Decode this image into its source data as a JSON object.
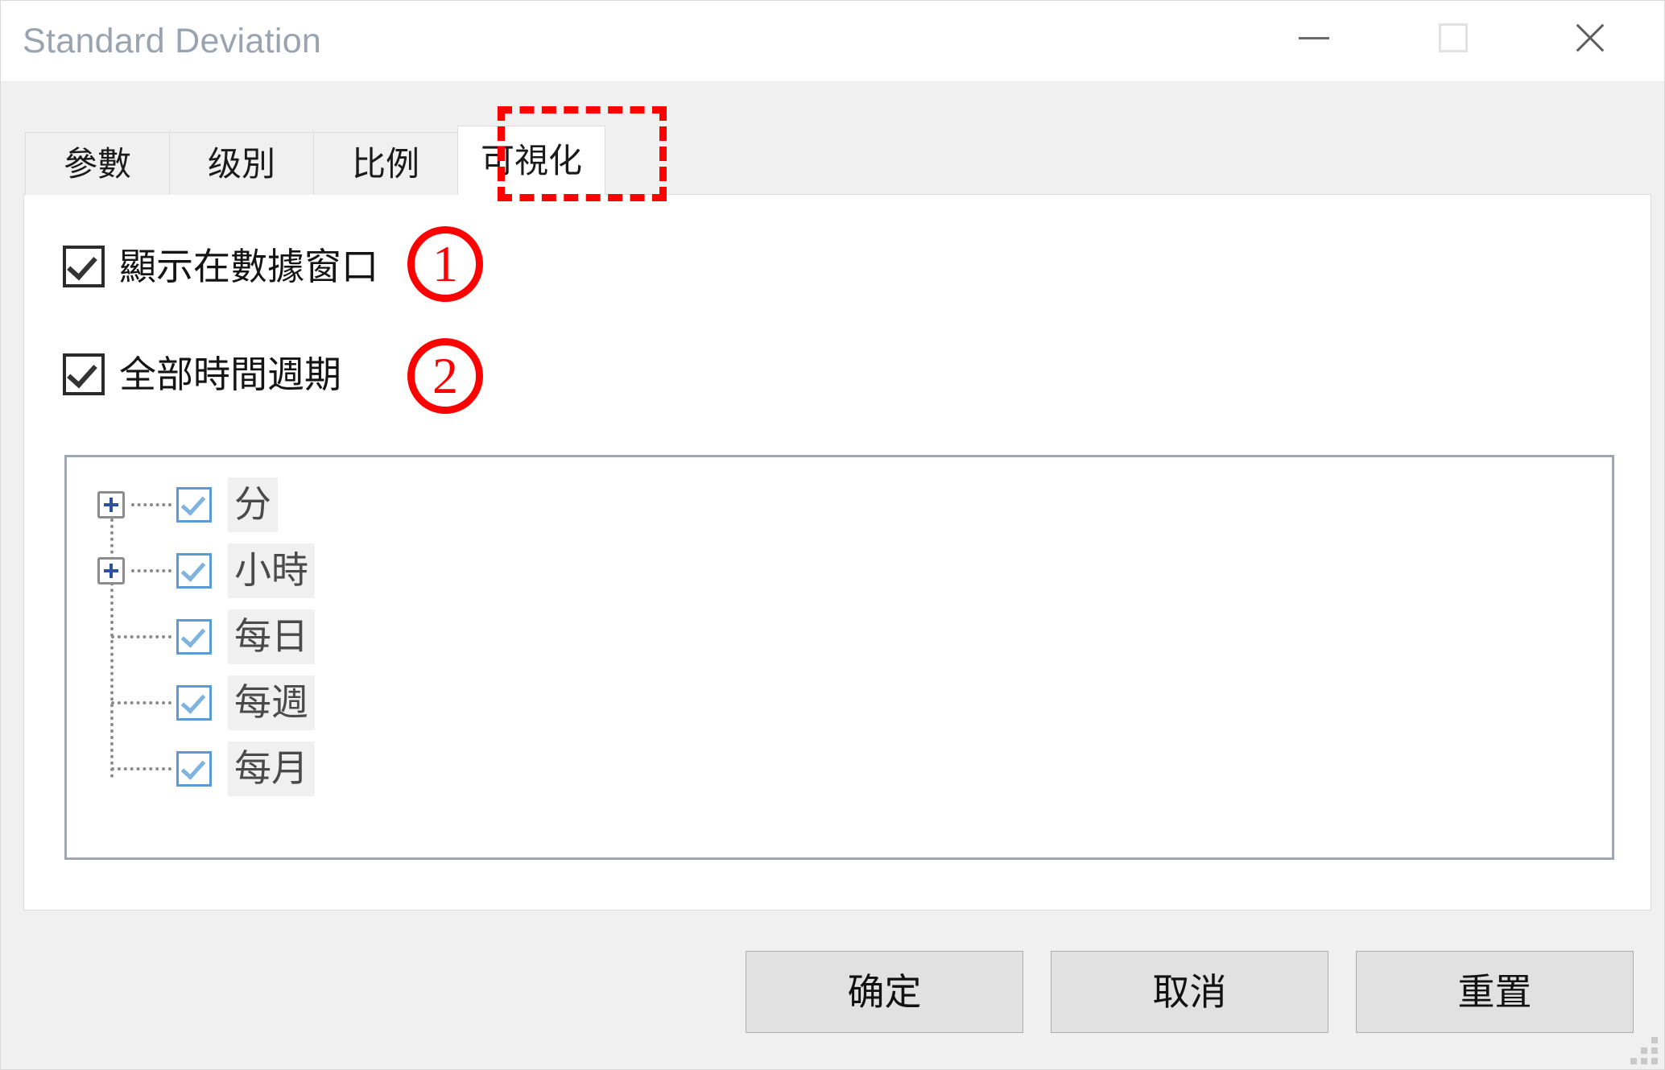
{
  "window": {
    "title": "Standard Deviation",
    "controls": [
      {
        "name": "minimize",
        "glyph": "minimize-icon"
      },
      {
        "name": "maximize",
        "glyph": "maximize-icon"
      },
      {
        "name": "close",
        "glyph": "close-icon"
      }
    ]
  },
  "tabs": [
    {
      "label": "參數",
      "selected": false
    },
    {
      "label": "级別",
      "selected": false
    },
    {
      "label": "比例",
      "selected": false
    },
    {
      "label": "可視化",
      "selected": true
    }
  ],
  "options": [
    {
      "label": "顯示在數據窗口",
      "checked": true,
      "annotation": "1"
    },
    {
      "label": "全部時間週期",
      "checked": true,
      "annotation": "2"
    }
  ],
  "timeframe_tree": {
    "items": [
      {
        "label": "分",
        "checked": true,
        "expandable": true,
        "expander": "plus-icon"
      },
      {
        "label": "小時",
        "checked": true,
        "expandable": true,
        "expander": "plus-icon"
      },
      {
        "label": "每日",
        "checked": true,
        "expandable": false,
        "expander": ""
      },
      {
        "label": "每週",
        "checked": true,
        "expandable": false,
        "expander": ""
      },
      {
        "label": "每月",
        "checked": true,
        "expandable": false,
        "expander": ""
      }
    ]
  },
  "buttons": {
    "ok": "确定",
    "cancel": "取消",
    "reset": "重置"
  },
  "annotations": {
    "one": "1",
    "two": "2"
  },
  "colors": {
    "annotation_red": "#fe0000",
    "title_text": "#9aa4b0",
    "dialog_bg": "#f0f0f0",
    "panel_bg": "#ffffff",
    "tree_checkbox_border": "#5b9bd5",
    "listbox_border": "#9fa6b2",
    "button_face": "#e1e1e1"
  }
}
